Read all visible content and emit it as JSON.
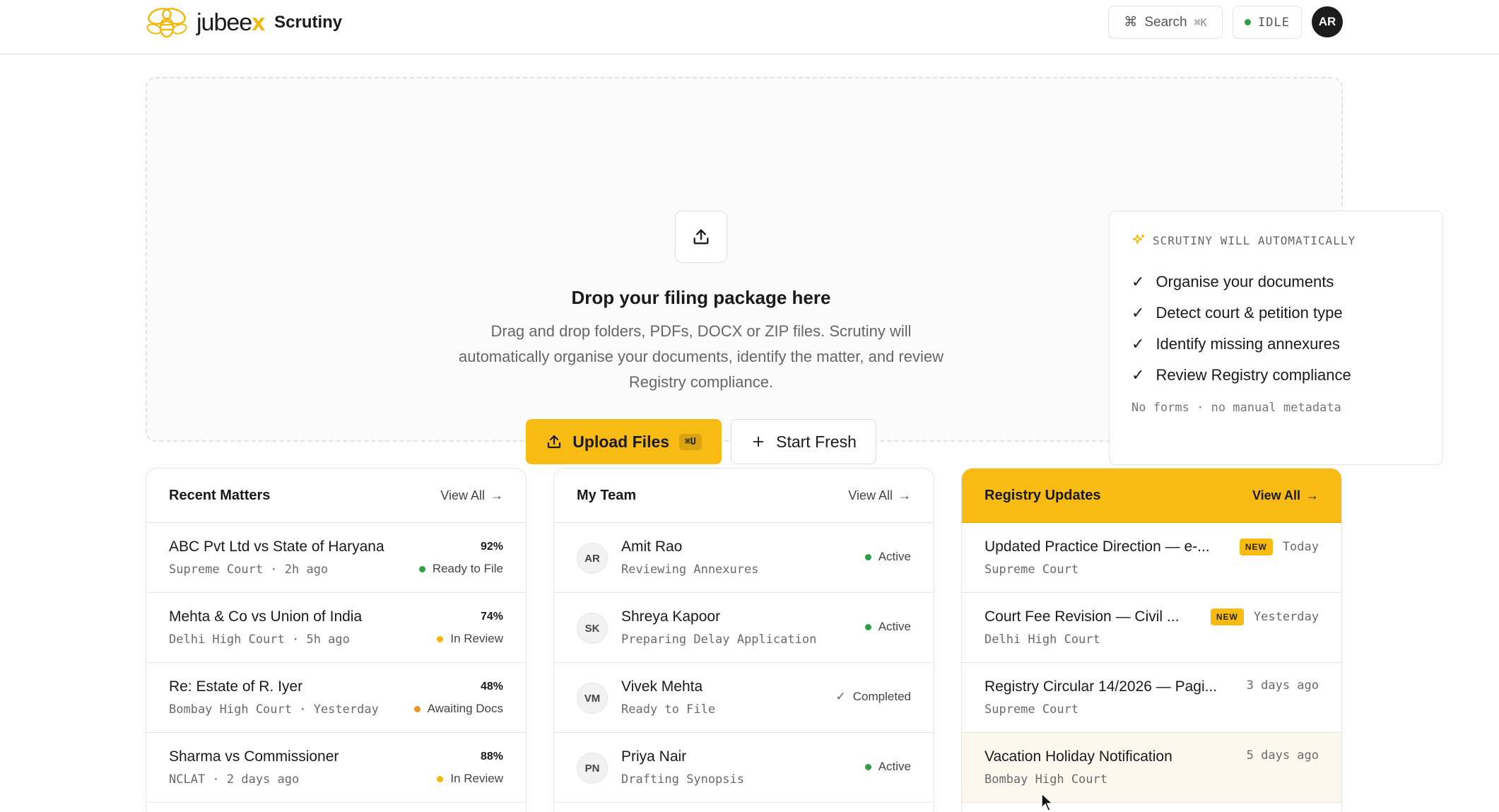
{
  "header": {
    "brand_name": "jubee",
    "brand_x": "x",
    "product": "Scrutiny",
    "search_label": "Search",
    "search_shortcut": "⌘K",
    "status": "IDLE",
    "avatar_initials": "AR"
  },
  "dropzone": {
    "title": "Drop your filing package here",
    "description": "Drag and drop folders, PDFs, DOCX or ZIP files. Scrutiny will automatically organise your documents, identify the matter, and review Registry compliance.",
    "upload_label": "Upload Files",
    "upload_shortcut": "⌘U",
    "fresh_label": "Start Fresh"
  },
  "auto": {
    "heading": "SCRUTINY WILL AUTOMATICALLY",
    "items": [
      "Organise your documents",
      "Detect court & petition type",
      "Identify missing annexures",
      "Review Registry compliance"
    ],
    "footer": "No forms · no manual metadata"
  },
  "recent": {
    "title": "Recent Matters",
    "view_all": "View All",
    "rows": [
      {
        "title": "ABC Pvt Ltd vs State of Haryana",
        "sub": "Supreme Court · 2h ago",
        "pct": "92%",
        "status": "Ready to File",
        "status_color": "#2f9e44"
      },
      {
        "title": "Mehta & Co vs Union of India",
        "sub": "Delhi High Court · 5h ago",
        "pct": "74%",
        "status": "In Review",
        "status_color": "#f0b90b"
      },
      {
        "title": "Re: Estate of R. Iyer",
        "sub": "Bombay High Court · Yesterday",
        "pct": "48%",
        "status": "Awaiting Docs",
        "status_color": "#e8932f"
      },
      {
        "title": "Sharma vs Commissioner",
        "sub": "NCLAT · 2 days ago",
        "pct": "88%",
        "status": "In Review",
        "status_color": "#f0b90b"
      }
    ]
  },
  "team": {
    "title": "My Team",
    "view_all": "View All",
    "rows": [
      {
        "initials": "AR",
        "name": "Amit Rao",
        "task": "Reviewing Annexures",
        "status": "Active"
      },
      {
        "initials": "SK",
        "name": "Shreya Kapoor",
        "task": "Preparing Delay Application",
        "status": "Active"
      },
      {
        "initials": "VM",
        "name": "Vivek Mehta",
        "task": "Ready to File",
        "status": "Completed"
      },
      {
        "initials": "PN",
        "name": "Priya Nair",
        "task": "Drafting Synopsis",
        "status": "Active"
      }
    ]
  },
  "registry": {
    "title": "Registry Updates",
    "view_all": "View All",
    "badge": "NEW",
    "rows": [
      {
        "title": "Updated Practice Direction — e-...",
        "court": "Supreme Court",
        "date": "Today",
        "is_new": true
      },
      {
        "title": "Court Fee Revision — Civil ...",
        "court": "Delhi High Court",
        "date": "Yesterday",
        "is_new": true
      },
      {
        "title": "Registry Circular 14/2026 — Pagi...",
        "court": "Supreme Court",
        "date": "3 days ago",
        "is_new": false
      },
      {
        "title": "Vacation Holiday Notification",
        "court": "Bombay High Court",
        "date": "5 days ago",
        "is_new": false
      }
    ]
  },
  "colors": {
    "accent": "#f8bb14",
    "active": "#2f9e44",
    "review": "#f0b90b",
    "awaiting": "#e8932f"
  }
}
